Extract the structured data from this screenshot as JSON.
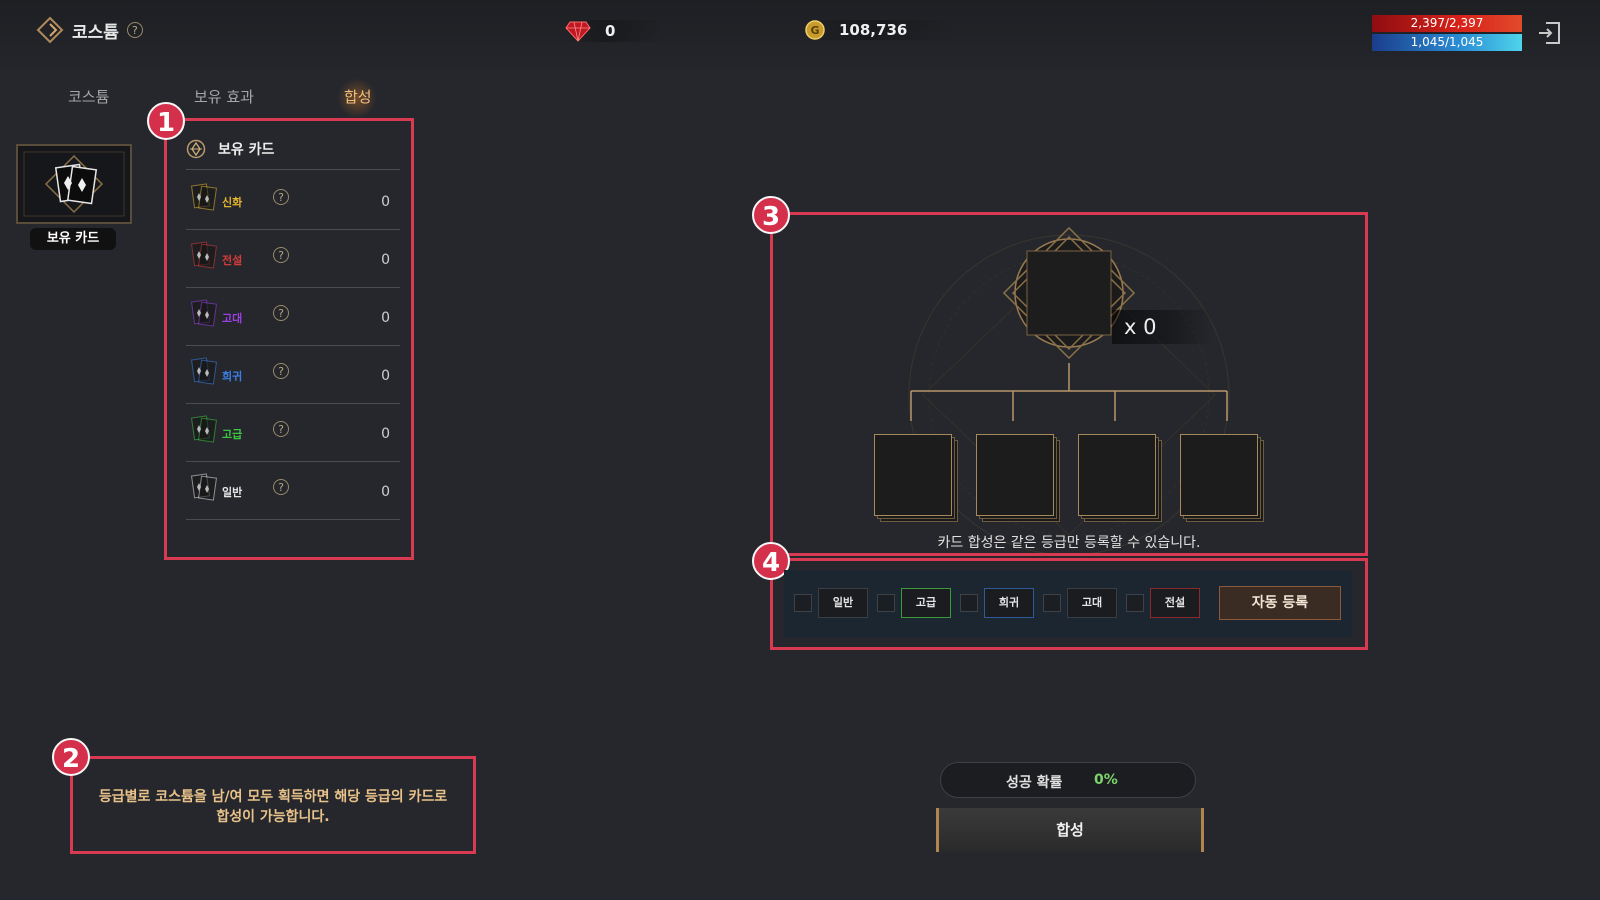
{
  "header": {
    "title": "코스튬",
    "help": "?",
    "gem_value": "0",
    "gold_value": "108,736",
    "hp": "2,397/2,397",
    "mp": "1,045/1,045",
    "hp_fraction": 1.0,
    "mp_fraction": 1.0
  },
  "tabs": [
    {
      "label": "코스튬",
      "active": false
    },
    {
      "label": "보유 효과",
      "active": false
    },
    {
      "label": "합성",
      "active": true
    }
  ],
  "sidebar": {
    "card_label": "보유 카드"
  },
  "owned_cards": {
    "title": "보유 카드",
    "grades": [
      {
        "name": "신화",
        "color": "#e4b42e",
        "count": "0"
      },
      {
        "name": "전설",
        "color": "#d53a3a",
        "count": "0"
      },
      {
        "name": "고대",
        "color": "#9a3fe0",
        "count": "0"
      },
      {
        "name": "희귀",
        "color": "#3b7fe6",
        "count": "0"
      },
      {
        "name": "고급",
        "color": "#3fc442",
        "count": "0"
      },
      {
        "name": "일반",
        "color": "#e6e6e6",
        "count": "0"
      }
    ]
  },
  "annotations": [
    "1",
    "2",
    "3",
    "4"
  ],
  "notice": {
    "line1": "등급별로 코스튬을 남/여 모두 획득하면 해당 등급의 카드로",
    "line2": "합성이 가능합니다."
  },
  "synthesis": {
    "multiplier": "x 0",
    "caption": "카드 합성은 같은 등급만 등록할 수 있습니다.",
    "slot_count": 4
  },
  "filters": {
    "grades": [
      {
        "label": "일반",
        "border": "#3a3d44"
      },
      {
        "label": "고급",
        "border": "#3c9a3a"
      },
      {
        "label": "희귀",
        "border": "#2f5a9a"
      },
      {
        "label": "고대",
        "border": "#3a3d44"
      },
      {
        "label": "전설",
        "border": "#8a2a2f"
      }
    ],
    "auto_button": "자동 등록"
  },
  "result": {
    "rate_label": "성공 확률",
    "rate_value": "0%",
    "synth_button": "합성"
  }
}
